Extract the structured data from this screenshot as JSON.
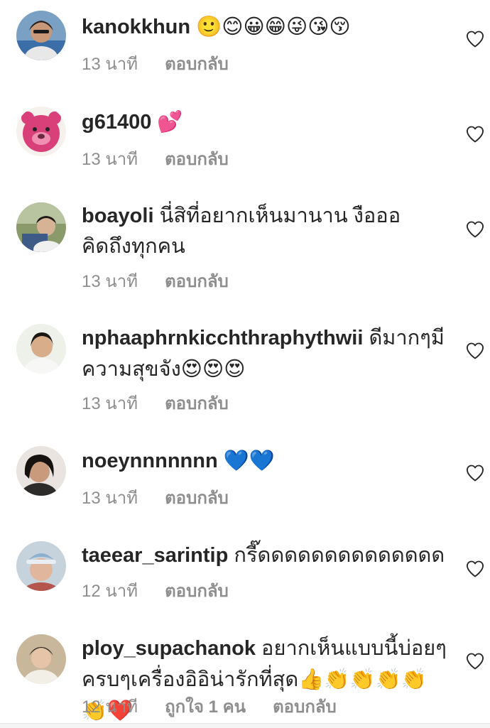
{
  "comments": [
    {
      "username": "kanokkhun",
      "text": "",
      "emoji": "🙂😊😀😁😜😘😚",
      "time": "13 นาที",
      "likes": "",
      "reply_label": "ตอบกลับ"
    },
    {
      "username": "g61400",
      "text": "",
      "emoji": "💕",
      "time": "13 นาที",
      "likes": "",
      "reply_label": "ตอบกลับ"
    },
    {
      "username": "boayoli",
      "text": "นี่สิที่อยากเห็นมานาน งือออ คิดถึงทุกคน",
      "emoji": "",
      "time": "13 นาที",
      "likes": "",
      "reply_label": "ตอบกลับ"
    },
    {
      "username": "nphaaphrnkicchthraphythwii",
      "text": "ดีมากๆมีความสุขจัง",
      "emoji": "😍😍😍",
      "time": "13 นาที",
      "likes": "",
      "reply_label": "ตอบกลับ"
    },
    {
      "username": "noeynnnnnnn",
      "text": "",
      "emoji": "💙💙",
      "time": "13 นาที",
      "likes": "",
      "reply_label": "ตอบกลับ"
    },
    {
      "username": "taeear_sarintip",
      "text": "กรี๊ดดดดดดดดดดดดดด",
      "emoji": "",
      "time": "12 นาที",
      "likes": "",
      "reply_label": "ตอบกลับ"
    },
    {
      "username": "ploy_supachanok",
      "text": "อยากเห็นแบบนี้บ่อยๆ ครบๆเครื่องอิอิน่ารักที่สุด",
      "emoji": "👍👏👏👏👏👏❤️",
      "time": "12 นาที",
      "likes": "ถูกใจ 1 คน",
      "reply_label": "ตอบกลับ"
    }
  ],
  "colors": {
    "text_primary": "#262626",
    "text_secondary": "#8e8e8e",
    "heart_outline": "#262626"
  },
  "icons": {
    "like": "heart-outline-icon"
  }
}
